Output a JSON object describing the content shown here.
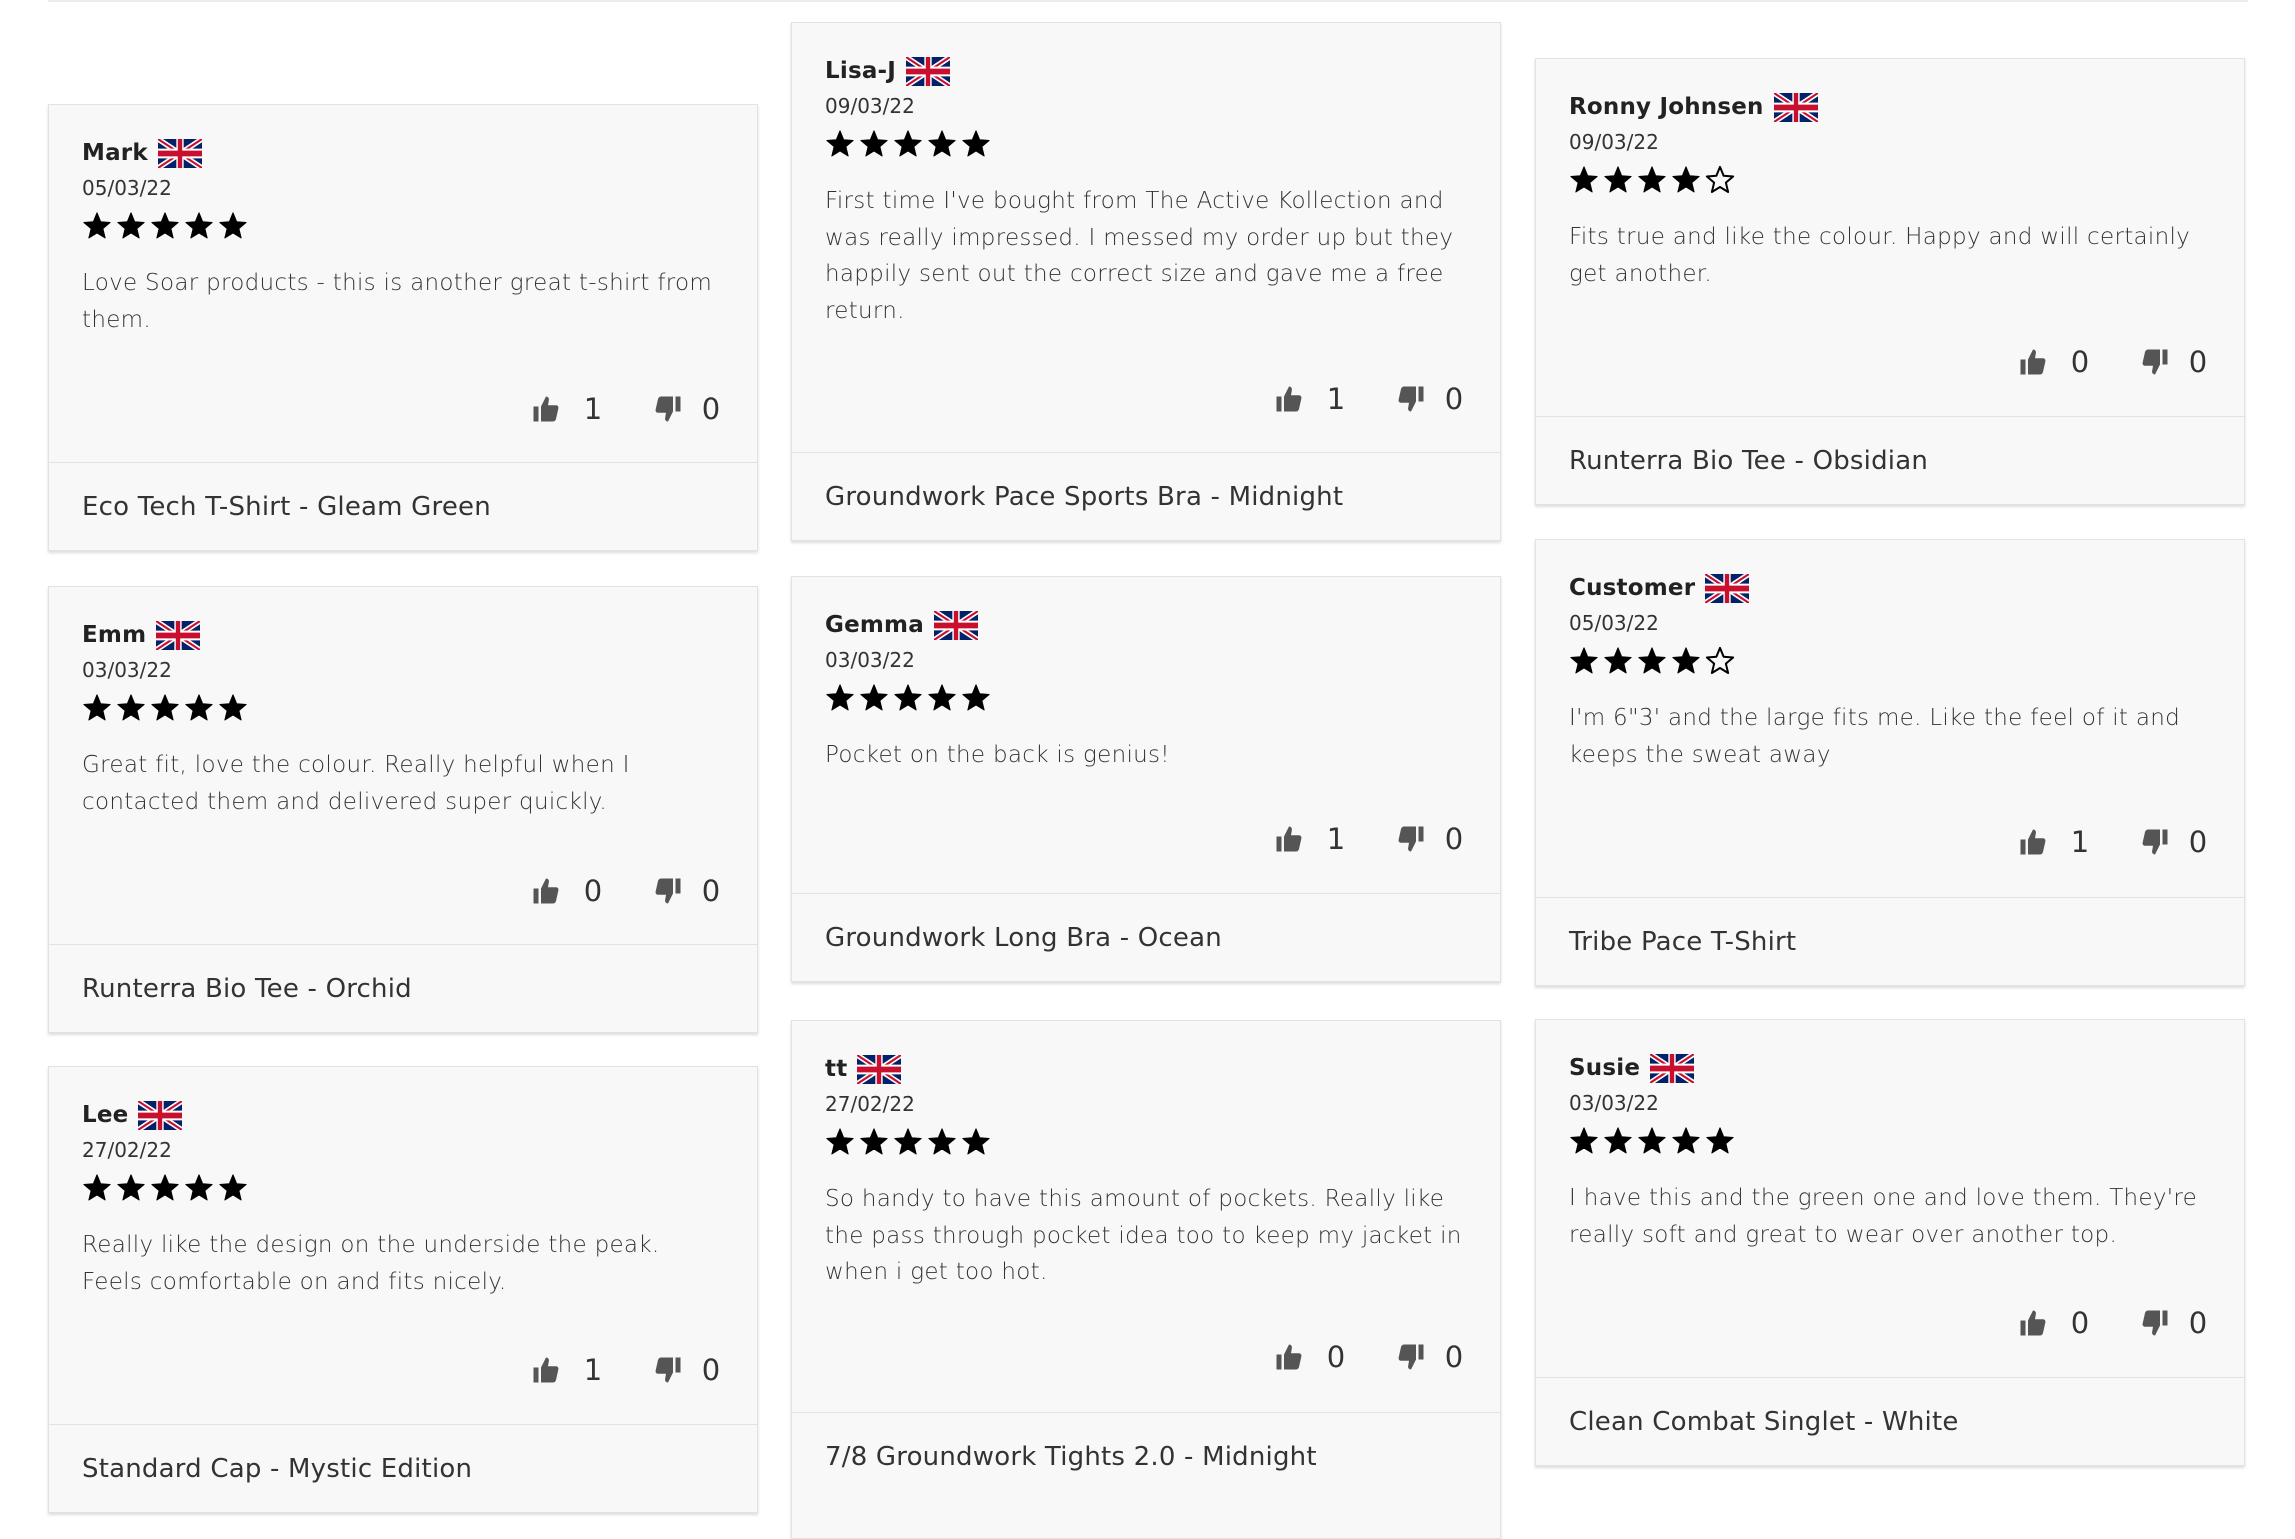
{
  "reviews": [
    {
      "name": "Mark",
      "date": "05/03/22",
      "rating": 5,
      "text": "Love Soar products - this is another great t-shirt from them.",
      "helpful_up": "1",
      "helpful_down": "0",
      "product": "Eco Tech T-Shirt - Gleam Green"
    },
    {
      "name": "Emm",
      "date": "03/03/22",
      "rating": 5,
      "text": "Great fit, love the colour. Really helpful when I contacted them and delivered super quickly.",
      "helpful_up": "0",
      "helpful_down": "0",
      "product": "Runterra Bio Tee - Orchid"
    },
    {
      "name": "Lee",
      "date": "27/02/22",
      "rating": 5,
      "text": "Really like the design on the underside the peak. Feels comfortable on and fits nicely.",
      "helpful_up": "1",
      "helpful_down": "0",
      "product": "Standard Cap - Mystic Edition"
    },
    {
      "name": "Lisa-J",
      "date": "09/03/22",
      "rating": 5,
      "text": "First time I've bought from The Active Kollection and was really impressed. I messed my order up but they happily sent out the correct size and gave me a free return.",
      "helpful_up": "1",
      "helpful_down": "0",
      "product": "Groundwork Pace Sports Bra - Midnight"
    },
    {
      "name": "Gemma",
      "date": "03/03/22",
      "rating": 5,
      "text": "Pocket on the back is genius!",
      "helpful_up": "1",
      "helpful_down": "0",
      "product": "Groundwork Long Bra - Ocean"
    },
    {
      "name": "tt",
      "date": "27/02/22",
      "rating": 5,
      "text": "So handy to have this amount of pockets. Really like the pass through pocket idea too to keep my jacket in when i get too hot.",
      "helpful_up": "0",
      "helpful_down": "0",
      "product": "7/8 Groundwork Tights 2.0 - Midnight"
    },
    {
      "name": "Ronny Johnsen",
      "date": "09/03/22",
      "rating": 4,
      "text": "Fits true and like the colour. Happy and will certainly get another.",
      "helpful_up": "0",
      "helpful_down": "0",
      "product": "Runterra Bio Tee - Obsidian"
    },
    {
      "name": "Customer",
      "date": "05/03/22",
      "rating": 4,
      "text": "I'm 6\"3' and the large fits me. Like the feel of it and keeps the sweat away",
      "helpful_up": "1",
      "helpful_down": "0",
      "product": "Tribe Pace T-Shirt"
    },
    {
      "name": "Susie",
      "date": "03/03/22",
      "rating": 5,
      "text": "I have this and the green one and love them. They're really soft and great to wear over another top.",
      "helpful_up": "0",
      "helpful_down": "0",
      "product": "Clean Combat Singlet - White"
    }
  ],
  "icons": {
    "flag": "uk-flag-icon",
    "star_full": "star-filled-icon",
    "star_empty": "star-outline-icon",
    "up": "thumbs-up-icon",
    "down": "thumbs-down-icon"
  },
  "colors": {
    "card_bg": "#f8f8f8",
    "border": "#e2e2e2",
    "text": "#333333",
    "star": "#000000",
    "thumb": "#555555",
    "flag_blue": "#012169",
    "flag_red": "#c8102e"
  }
}
